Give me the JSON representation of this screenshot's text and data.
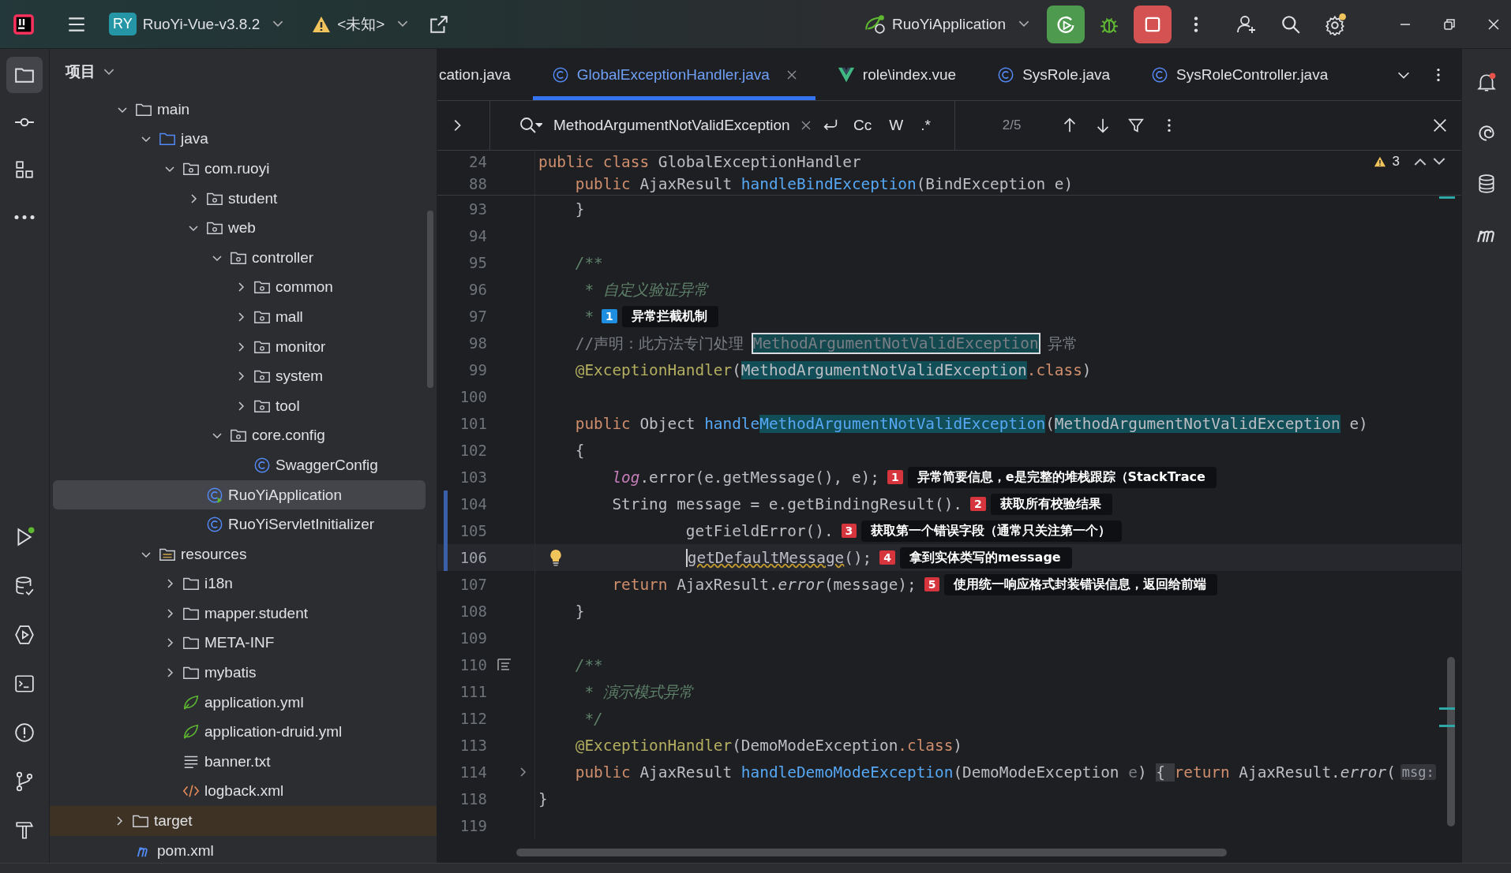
{
  "toolbar": {
    "project_badge": "RY",
    "project": "RuoYi-Vue-v3.8.2",
    "vcs_branch": "<未知>",
    "run_config": "RuoYiApplication",
    "settings_update": true
  },
  "left_strip": {
    "top": [
      {
        "kind": "project",
        "selected": true
      },
      {
        "kind": "commit",
        "selected": false
      },
      {
        "kind": "structure",
        "selected": false
      },
      {
        "kind": "more",
        "selected": false
      }
    ],
    "bottom": [
      {
        "kind": "run",
        "selected": false
      },
      {
        "kind": "database",
        "selected": false
      },
      {
        "kind": "services",
        "selected": false
      },
      {
        "kind": "terminal",
        "selected": false
      },
      {
        "kind": "problems",
        "selected": false
      },
      {
        "kind": "git",
        "selected": false
      },
      {
        "kind": "build",
        "selected": false
      }
    ]
  },
  "project": {
    "title": "项目",
    "tree": [
      {
        "label": "main",
        "kind": "folder",
        "expanded": true,
        "selected": false,
        "children": [
          {
            "label": "java",
            "kind": "source",
            "expanded": true,
            "selected": false,
            "children": [
              {
                "label": "com.ruoyi",
                "kind": "package",
                "expanded": true,
                "selected": false,
                "children": [
                  {
                    "label": "student",
                    "kind": "package",
                    "expanded": false,
                    "selected": false
                  },
                  {
                    "label": "web",
                    "kind": "package",
                    "expanded": true,
                    "selected": false,
                    "children": [
                      {
                        "label": "controller",
                        "kind": "package",
                        "expanded": true,
                        "selected": false,
                        "children": [
                          {
                            "label": "common",
                            "kind": "package",
                            "expanded": false,
                            "selected": false
                          },
                          {
                            "label": "mall",
                            "kind": "package",
                            "expanded": false,
                            "selected": false
                          },
                          {
                            "label": "monitor",
                            "kind": "package",
                            "expanded": false,
                            "selected": false
                          },
                          {
                            "label": "system",
                            "kind": "package",
                            "expanded": false,
                            "selected": false
                          },
                          {
                            "label": "tool",
                            "kind": "package",
                            "expanded": false,
                            "selected": false
                          }
                        ]
                      },
                      {
                        "label": "core.config",
                        "kind": "package",
                        "expanded": true,
                        "selected": false,
                        "children": [
                          {
                            "label": "SwaggerConfig",
                            "kind": "class",
                            "selected": false
                          }
                        ]
                      }
                    ]
                  },
                  {
                    "label": "RuoYiApplication",
                    "kind": "app-class",
                    "selected": true
                  },
                  {
                    "label": "RuoYiServletInitializer",
                    "kind": "class",
                    "selected": false
                  }
                ]
              }
            ]
          },
          {
            "label": "resources",
            "kind": "resources",
            "expanded": true,
            "selected": false,
            "children": [
              {
                "label": "i18n",
                "kind": "folder",
                "expanded": false,
                "selected": false
              },
              {
                "label": "mapper.student",
                "kind": "folder",
                "expanded": false,
                "selected": false
              },
              {
                "label": "META-INF",
                "kind": "folder",
                "expanded": false,
                "selected": false
              },
              {
                "label": "mybatis",
                "kind": "folder",
                "expanded": false,
                "selected": false
              },
              {
                "label": "application.yml",
                "kind": "spring",
                "selected": false
              },
              {
                "label": "application-druid.yml",
                "kind": "spring",
                "selected": false
              },
              {
                "label": "banner.txt",
                "kind": "text",
                "selected": false
              },
              {
                "label": "logback.xml",
                "kind": "xml",
                "selected": false
              }
            ]
          }
        ]
      },
      {
        "label": "target",
        "kind": "excluded",
        "expanded": false,
        "selected": false
      },
      {
        "label": "pom.xml",
        "kind": "maven",
        "selected": false
      }
    ]
  },
  "tabs": [
    {
      "label": "cation.java",
      "kind": "cut",
      "selected": false,
      "closable": false
    },
    {
      "label": "GlobalExceptionHandler.java",
      "kind": "java",
      "selected": true,
      "closable": true
    },
    {
      "label": "role\\index.vue",
      "kind": "vue",
      "selected": false,
      "closable": false
    },
    {
      "label": "SysRole.java",
      "kind": "java",
      "selected": false,
      "closable": false
    },
    {
      "label": "SysRoleController.java",
      "kind": "java",
      "selected": false,
      "closable": false
    }
  ],
  "search": {
    "value": "MethodArgumentNotValidException",
    "options": [
      "Cc",
      "W",
      ".*"
    ],
    "count": "2/5"
  },
  "editor": {
    "warnings": "3",
    "sticky": [
      {
        "number": "24",
        "tokens": [
          {
            "kind": "kw",
            "text": "public class "
          },
          {
            "kind": "plain",
            "text": "GlobalExceptionHandler"
          }
        ]
      },
      {
        "number": "88",
        "tokens": [
          {
            "kind": "kw",
            "text": "    public "
          },
          {
            "kind": "plain",
            "text": "AjaxResult "
          },
          {
            "kind": "fn",
            "text": "handleBindException"
          },
          {
            "kind": "plain",
            "text": "(BindException e)"
          }
        ]
      }
    ],
    "lines": [
      {
        "number": "93",
        "changed": false,
        "current": false,
        "tokens": [
          {
            "kind": "plain",
            "text": "    }"
          }
        ]
      },
      {
        "number": "94",
        "changed": false,
        "current": false
      },
      {
        "number": "95",
        "changed": false,
        "current": false,
        "tokens": [
          {
            "kind": "doc",
            "text": "    /**"
          }
        ]
      },
      {
        "number": "96",
        "changed": false,
        "current": false,
        "tokens": [
          {
            "kind": "doc",
            "text": "     * 自定义验证异常"
          }
        ]
      },
      {
        "number": "97",
        "changed": false,
        "current": false,
        "tokens": [
          {
            "kind": "doc",
            "text": "     *"
          }
        ],
        "note": {
          "number": "1",
          "text": "异常拦截机制",
          "color": "#1e8ee0"
        }
      },
      {
        "number": "98",
        "changed": false,
        "current": false,
        "tokens": [
          {
            "kind": "comment",
            "text": "    //声明：此方法专门处理 "
          },
          {
            "kind": "current-match",
            "text": "MethodArgumentNotValidException"
          },
          {
            "kind": "comment",
            "text": " 异常"
          }
        ]
      },
      {
        "number": "99",
        "changed": false,
        "current": false,
        "tokens": [
          {
            "kind": "ann",
            "text": "    @ExceptionHandler"
          },
          {
            "kind": "plain",
            "text": "("
          },
          {
            "kind": "match",
            "text": "MethodArgumentNotValidException"
          },
          {
            "kind": "kw",
            "text": ".class"
          },
          {
            "kind": "plain",
            "text": ")"
          }
        ]
      },
      {
        "number": "100",
        "changed": false,
        "current": false
      },
      {
        "number": "101",
        "changed": false,
        "current": false,
        "tokens": [
          {
            "kind": "kw",
            "text": "    public "
          },
          {
            "kind": "plain",
            "text": "Object "
          },
          {
            "kind": "fn",
            "text": "handle"
          },
          {
            "kind": "match-fn",
            "text": "MethodArgumentNotValidException"
          },
          {
            "kind": "plain",
            "text": "("
          },
          {
            "kind": "match",
            "text": "MethodArgumentNotValidException"
          },
          {
            "kind": "plain",
            "text": " e)"
          }
        ]
      },
      {
        "number": "102",
        "changed": false,
        "current": false,
        "tokens": [
          {
            "kind": "plain",
            "text": "    {"
          }
        ]
      },
      {
        "number": "103",
        "changed": false,
        "current": false,
        "tokens": [
          {
            "kind": "static",
            "text": "        log"
          },
          {
            "kind": "plain",
            "text": ".error(e.getMessage(), e);"
          }
        ],
        "note": {
          "number": "1",
          "text": "异常简要信息，e是完整的堆栈跟踪（StackTrace",
          "color": "#d7353d"
        }
      },
      {
        "number": "104",
        "changed": true,
        "current": false,
        "tokens": [
          {
            "kind": "plain",
            "text": "        String message = e.getBindingResult()."
          }
        ],
        "note": {
          "number": "2",
          "text": "获取所有校验结果",
          "color": "#d7353d"
        }
      },
      {
        "number": "105",
        "changed": true,
        "current": false,
        "tokens": [
          {
            "kind": "plain",
            "text": "                getFieldError()."
          }
        ],
        "note": {
          "number": "3",
          "text": "获取第一个错误字段（通常只关注第一个）",
          "color": "#d7353d"
        }
      },
      {
        "number": "106",
        "changed": true,
        "current": true,
        "kind": "bulb",
        "tokens": [
          {
            "kind": "warn",
            "text": "                getDefaultMessage"
          },
          {
            "kind": "plain",
            "text": "();"
          }
        ],
        "note": {
          "number": "4",
          "text": "拿到实体类写的message",
          "color": "#d7353d"
        }
      },
      {
        "number": "107",
        "changed": false,
        "current": false,
        "tokens": [
          {
            "kind": "kw",
            "text": "        return "
          },
          {
            "kind": "plain",
            "text": "AjaxResult."
          },
          {
            "kind": "italic",
            "text": "error"
          },
          {
            "kind": "plain",
            "text": "(message);"
          }
        ],
        "note": {
          "number": "5",
          "text": "使用统一响应格式封装错误信息，返回给前端",
          "color": "#d7353d"
        }
      },
      {
        "number": "108",
        "changed": false,
        "current": false,
        "tokens": [
          {
            "kind": "plain",
            "text": "    }"
          }
        ]
      },
      {
        "number": "109",
        "changed": false,
        "current": false
      },
      {
        "number": "110",
        "changed": false,
        "current": false,
        "kind": "doc",
        "tokens": [
          {
            "kind": "doc",
            "text": "    /**"
          }
        ]
      },
      {
        "number": "111",
        "changed": false,
        "current": false,
        "tokens": [
          {
            "kind": "doc",
            "text": "     * 演示模式异常"
          }
        ]
      },
      {
        "number": "112",
        "changed": false,
        "current": false,
        "tokens": [
          {
            "kind": "doc",
            "text": "     */"
          }
        ]
      },
      {
        "number": "113",
        "changed": false,
        "current": false,
        "tokens": [
          {
            "kind": "ann",
            "text": "    @ExceptionHandler"
          },
          {
            "kind": "plain",
            "text": "(DemoModeException"
          },
          {
            "kind": "kw",
            "text": ".class"
          },
          {
            "kind": "plain",
            "text": ")"
          }
        ]
      },
      {
        "number": "114",
        "changed": false,
        "current": false,
        "kind": "fold",
        "tokens": [
          {
            "kind": "kw",
            "text": "    public "
          },
          {
            "kind": "plain",
            "text": "AjaxResult "
          },
          {
            "kind": "fn",
            "text": "handleDemoModeException"
          },
          {
            "kind": "plain",
            "text": "(DemoModeException "
          },
          {
            "kind": "param",
            "text": "e"
          },
          {
            "kind": "plain",
            "text": ")"
          },
          {
            "kind": "fold",
            "text": " { "
          },
          {
            "kind": "kw",
            "text": "return "
          },
          {
            "kind": "plain",
            "text": "AjaxResult."
          },
          {
            "kind": "italic",
            "text": "error"
          },
          {
            "kind": "plain",
            "text": "("
          },
          {
            "kind": "hint",
            "text": "msg:"
          }
        ]
      },
      {
        "number": "118",
        "changed": false,
        "current": false,
        "tokens": [
          {
            "kind": "plain",
            "text": "}"
          }
        ]
      },
      {
        "number": "119",
        "changed": false,
        "current": false
      }
    ]
  },
  "right_strip": [
    {
      "kind": "notifications",
      "badge": true
    },
    {
      "kind": "ai"
    },
    {
      "kind": "database"
    },
    {
      "kind": "maven"
    }
  ]
}
